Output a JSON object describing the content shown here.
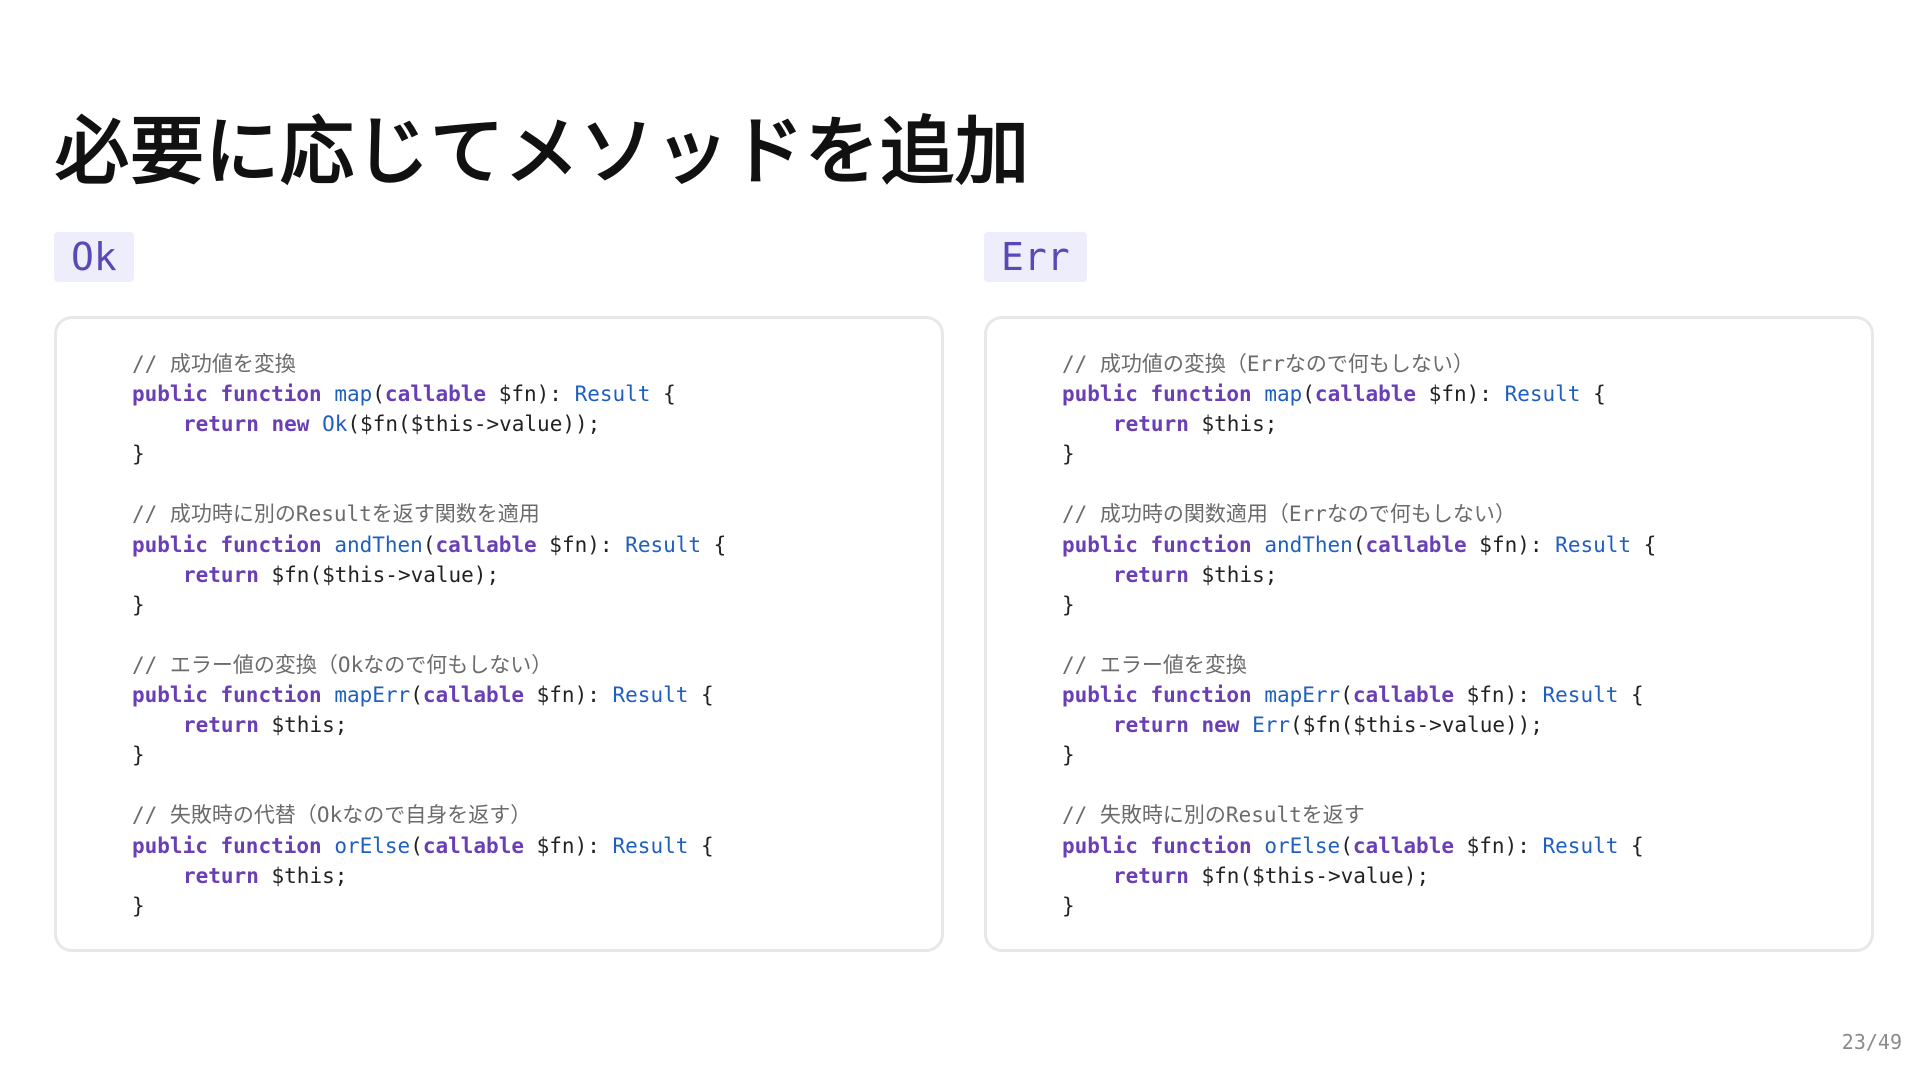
{
  "slide": {
    "title": "必要に応じてメソッドを追加",
    "page_number": "23/49"
  },
  "panels": [
    {
      "label": "Ok",
      "blocks": [
        {
          "comment": "// 成功値を変換",
          "kw_public": "public",
          "kw_function": "function",
          "method_name": "map",
          "open_paren": "(",
          "kw_callable": "callable",
          "param_text": " $fn): ",
          "return_type": "Result",
          "open_brace": " {",
          "body": {
            "kw_return": "return",
            "kw_new": "new",
            "ctor": "Ok",
            "rest": "($fn($this->value));"
          },
          "close_brace": "}"
        },
        {
          "comment": "// 成功時に別のResultを返す関数を適用",
          "kw_public": "public",
          "kw_function": "function",
          "method_name": "andThen",
          "open_paren": "(",
          "kw_callable": "callable",
          "param_text": " $fn): ",
          "return_type": "Result",
          "open_brace": " {",
          "body": {
            "kw_return": "return",
            "rest": "$fn($this->value);"
          },
          "close_brace": "}"
        },
        {
          "comment": "// エラー値の変換（Okなので何もしない）",
          "kw_public": "public",
          "kw_function": "function",
          "method_name": "mapErr",
          "open_paren": "(",
          "kw_callable": "callable",
          "param_text": " $fn): ",
          "return_type": "Result",
          "open_brace": " {",
          "body": {
            "kw_return": "return",
            "rest": "$this;"
          },
          "close_brace": "}"
        },
        {
          "comment": "// 失敗時の代替（Okなので自身を返す）",
          "kw_public": "public",
          "kw_function": "function",
          "method_name": "orElse",
          "open_paren": "(",
          "kw_callable": "callable",
          "param_text": " $fn): ",
          "return_type": "Result",
          "open_brace": " {",
          "body": {
            "kw_return": "return",
            "rest": "$this;"
          },
          "close_brace": "}"
        }
      ]
    },
    {
      "label": "Err",
      "blocks": [
        {
          "comment": "// 成功値の変換（Errなので何もしない）",
          "kw_public": "public",
          "kw_function": "function",
          "method_name": "map",
          "open_paren": "(",
          "kw_callable": "callable",
          "param_text": " $fn): ",
          "return_type": "Result",
          "open_brace": " {",
          "body": {
            "kw_return": "return",
            "rest": "$this;"
          },
          "close_brace": "}"
        },
        {
          "comment": "// 成功時の関数適用（Errなので何もしない）",
          "kw_public": "public",
          "kw_function": "function",
          "method_name": "andThen",
          "open_paren": "(",
          "kw_callable": "callable",
          "param_text": " $fn): ",
          "return_type": "Result",
          "open_brace": " {",
          "body": {
            "kw_return": "return",
            "rest": "$this;"
          },
          "close_brace": "}"
        },
        {
          "comment": "// エラー値を変換",
          "kw_public": "public",
          "kw_function": "function",
          "method_name": "mapErr",
          "open_paren": "(",
          "kw_callable": "callable",
          "param_text": " $fn): ",
          "return_type": "Result",
          "open_brace": " {",
          "body": {
            "kw_return": "return",
            "kw_new": "new",
            "ctor": "Err",
            "rest": "($fn($this->value));"
          },
          "close_brace": "}"
        },
        {
          "comment": "// 失敗時に別のResultを返す",
          "kw_public": "public",
          "kw_function": "function",
          "method_name": "orElse",
          "open_paren": "(",
          "kw_callable": "callable",
          "param_text": " $fn): ",
          "return_type": "Result",
          "open_brace": " {",
          "body": {
            "kw_return": "return",
            "rest": "$fn($this->value);"
          },
          "close_brace": "}"
        }
      ]
    }
  ],
  "colors": {
    "keyword": "#6a3fb5",
    "function_name": "#1f5fbf",
    "type": "#1f5fbf",
    "comment": "#6b6b6b",
    "badge_text": "#5a48b8",
    "badge_bg": "#eeedfb",
    "panel_border": "#e8e8e8"
  }
}
